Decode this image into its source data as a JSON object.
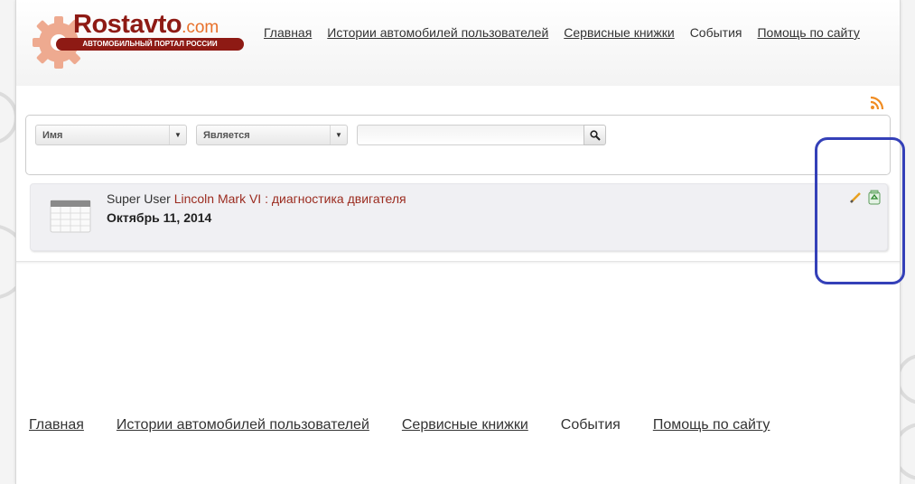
{
  "brand": {
    "name": "Rostavto",
    "domain": ".com",
    "tagline": "АВТОМОБИЛЬНЫЙ ПОРТАЛ РОССИИ"
  },
  "nav": {
    "items": [
      {
        "label": "Главная"
      },
      {
        "label": "Истории автомобилей пользователей"
      },
      {
        "label": "Сервисные книжки"
      },
      {
        "label": "События"
      },
      {
        "label": "Помощь по сайту"
      }
    ]
  },
  "filter": {
    "field_select": "Имя",
    "condition_select": "Является",
    "search_value": ""
  },
  "event": {
    "author": "Super User",
    "title": "Lincoln Mark VI : диагностика двигателя",
    "date": "Октябрь 11, 2014"
  },
  "footer": {
    "items": [
      {
        "label": "Главная"
      },
      {
        "label": "Истории автомобилей пользователей"
      },
      {
        "label": "Сервисные книжки"
      },
      {
        "label": "События"
      },
      {
        "label": "Помощь по сайту"
      }
    ]
  },
  "colors": {
    "brand_dark_red": "#8e1a14",
    "brand_orange": "#e8702a",
    "link_red": "#9b2b1f",
    "highlight_blue": "#3440b8"
  },
  "icons": [
    "gear-logo-icon",
    "rss-icon",
    "chevron-down-icon",
    "search-icon",
    "calendar-icon",
    "pencil-icon",
    "recycle-bin-icon"
  ]
}
